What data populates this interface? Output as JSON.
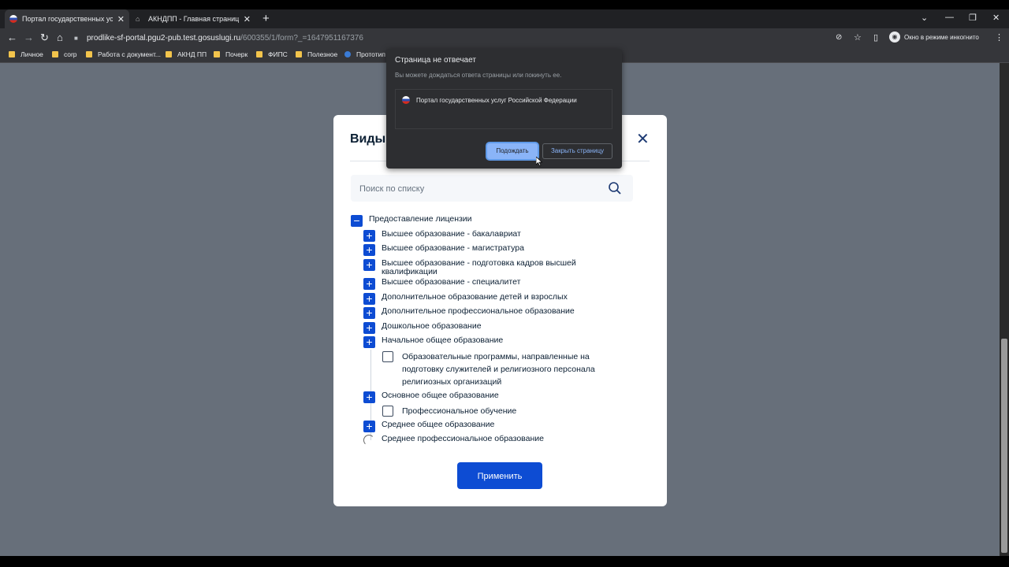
{
  "browser": {
    "tabs": [
      {
        "title": "Портал государственных услуг Р",
        "active": true
      },
      {
        "title": "АКНДПП - Главная страница",
        "active": false
      }
    ],
    "address": {
      "host": "prodlike-sf-portal.pgu2-pub.test.gosuslugi.ru",
      "path": "/600355/1/form?_=1647951167376"
    },
    "incognito_label": "Окно в режиме инкогнито",
    "bookmarks": [
      "Личное",
      "corp",
      "Работа с документ...",
      "АКНД ПП",
      "Почерк",
      "ФИПС",
      "Полезное",
      "Прототип"
    ]
  },
  "modal": {
    "title": "Виды",
    "search_placeholder": "Поиск по списку",
    "apply_label": "Применить",
    "tree": [
      {
        "label": "Предоставление лицензии",
        "type": "minus"
      },
      {
        "label": "Высшее образование - бакалавриат",
        "type": "plus"
      },
      {
        "label": "Высшее образование - магистратура",
        "type": "plus"
      },
      {
        "label": "Высшее образование - подготовка кадров высшей квалификации",
        "type": "plus"
      },
      {
        "label": "Высшее образование - специалитет",
        "type": "plus"
      },
      {
        "label": "Дополнительное образование детей и взрослых",
        "type": "plus"
      },
      {
        "label": "Дополнительное профессиональное образование",
        "type": "plus"
      },
      {
        "label": "Дошкольное образование",
        "type": "plus"
      },
      {
        "label": "Начальное общее образование",
        "type": "plus"
      },
      {
        "label": "Образовательные программы, направленные на подготовку служителей и религиозного персонала религиозных организаций",
        "type": "checkbox"
      },
      {
        "label": "Основное общее образование",
        "type": "plus"
      },
      {
        "label": "Профессиональное обучение",
        "type": "checkbox"
      },
      {
        "label": "Среднее общее образование",
        "type": "plus"
      },
      {
        "label": "Среднее профессиональное образование",
        "type": "loading"
      }
    ]
  },
  "dialog": {
    "title": "Страница не отвечает",
    "text": "Вы можете дождаться ответа страницы или покинуть ее.",
    "page_title": "Портал государственных услуг Российской Федерации",
    "wait_label": "Подождать",
    "close_label": "Закрыть страницу"
  }
}
